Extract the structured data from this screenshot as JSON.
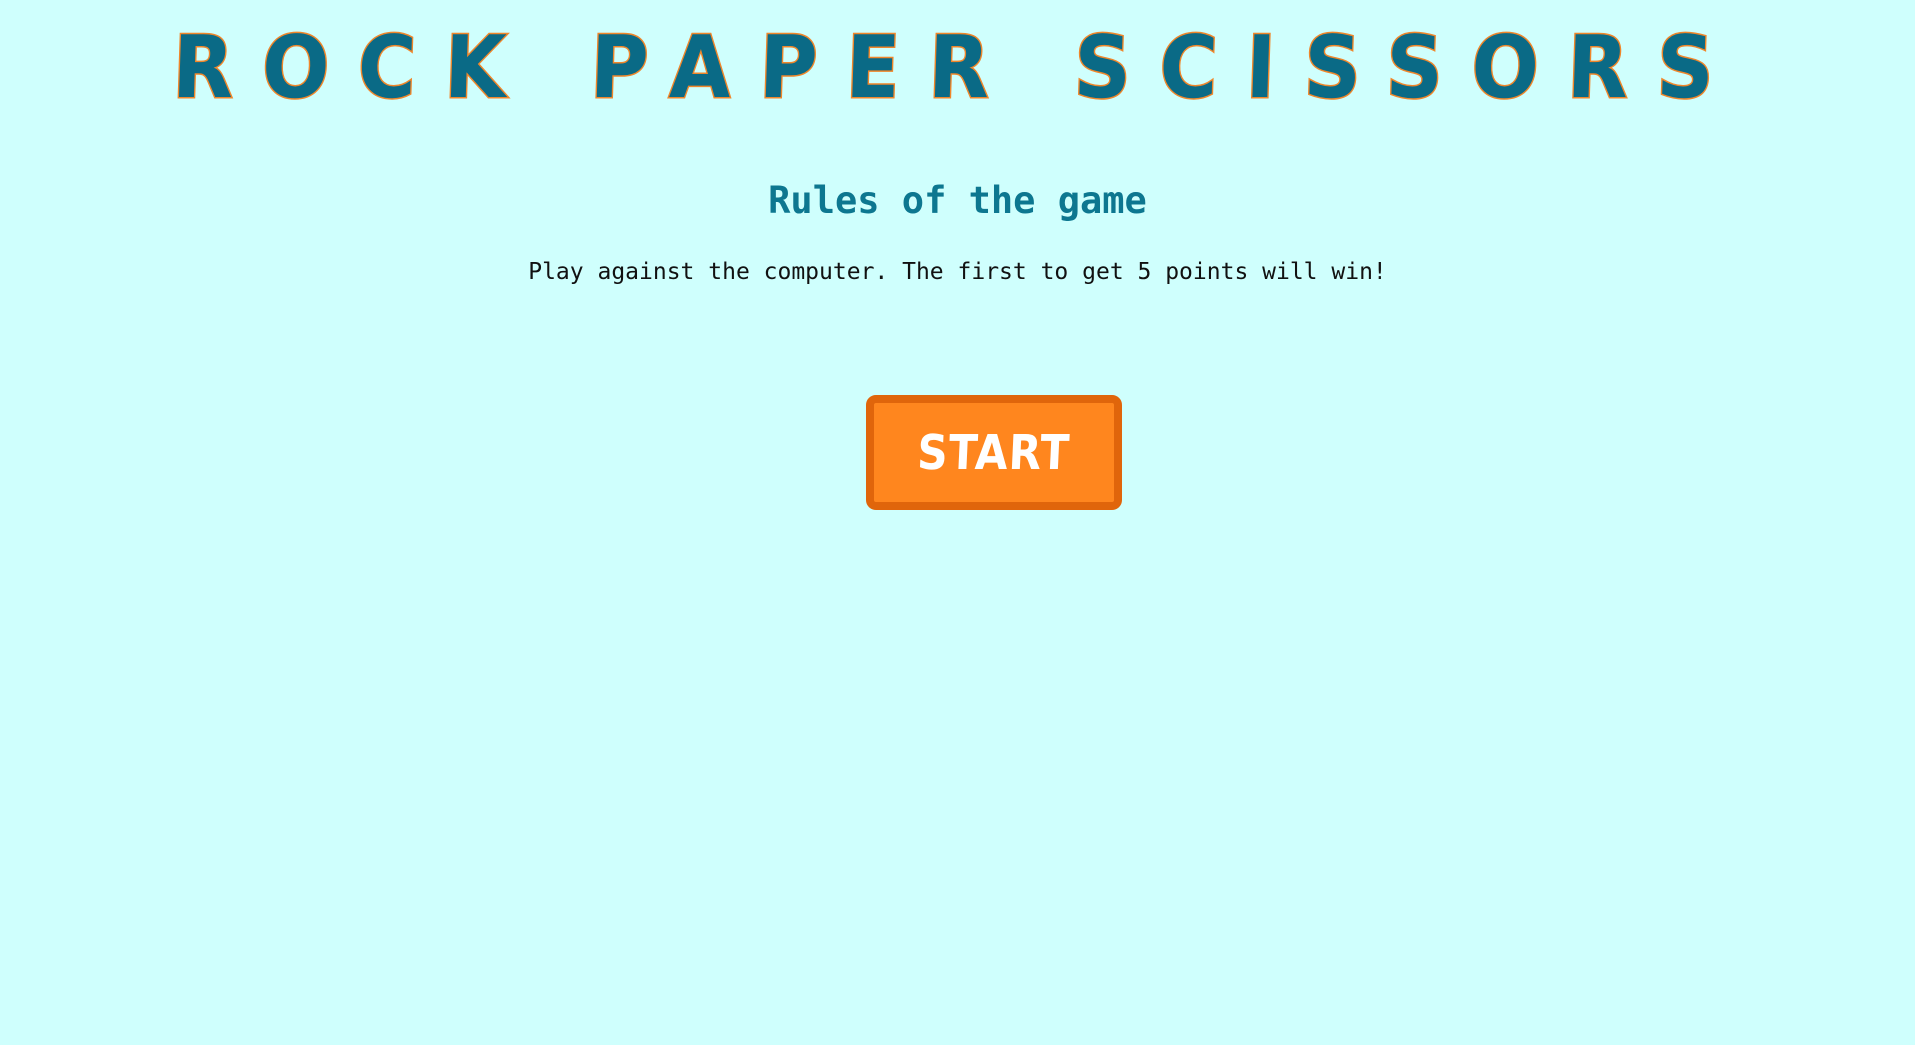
{
  "header": {
    "title": "ROCK PAPER SCISSORS"
  },
  "rules": {
    "heading": "Rules of the game",
    "text": "Play against the computer. The first to get 5 points will win!"
  },
  "controls": {
    "start_label": "START"
  },
  "colors": {
    "background": "#cffffd",
    "title_fill": "#0a6a86",
    "title_outline": "#f0862a",
    "heading": "#0d7790",
    "button_fill": "#ff861e",
    "button_border": "#e0650b"
  }
}
